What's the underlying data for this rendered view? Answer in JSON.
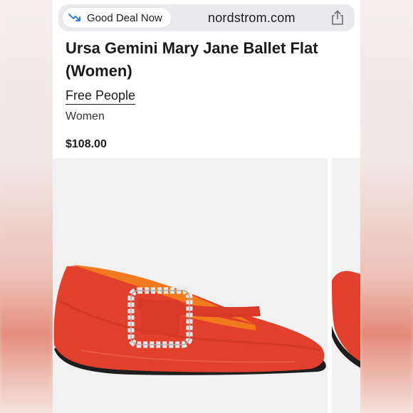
{
  "browser": {
    "deal_label": "Good Deal Now",
    "domain": "nordstrom.com"
  },
  "product": {
    "title": "Ursa Gemini Mary Jane Ballet Flat (Women)",
    "brand": "Free People",
    "category": "Women",
    "price": "$108.00"
  },
  "colors": {
    "shoe": "#e0402c",
    "lining": "#f07a1c",
    "deal_icon": "#2f7dd8"
  },
  "icons": {
    "deal": "trend-down-icon",
    "share": "share-icon"
  }
}
